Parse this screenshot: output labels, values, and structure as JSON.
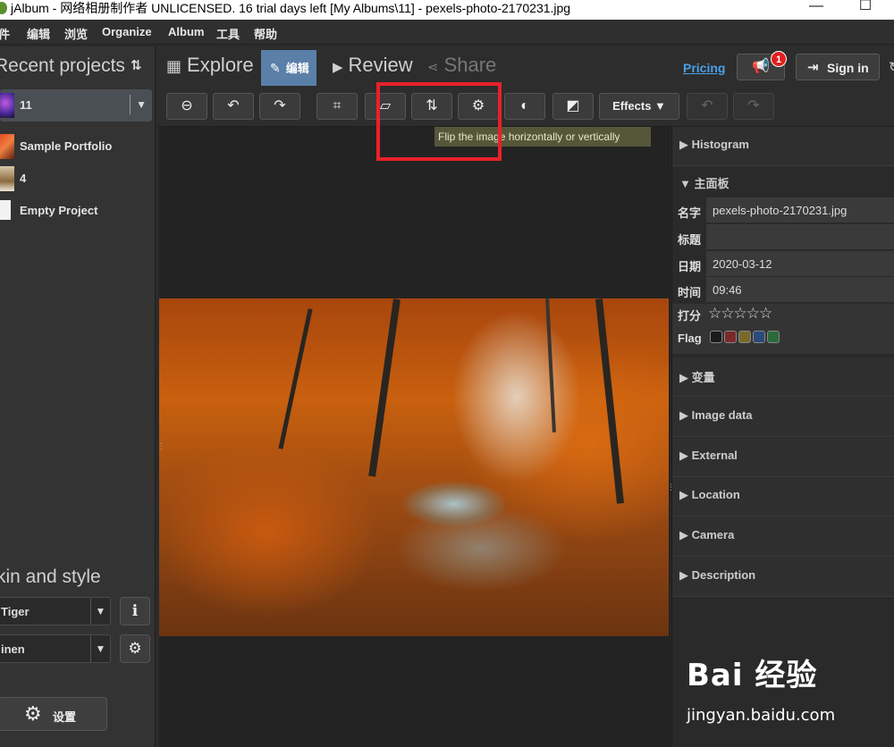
{
  "window": {
    "title": "jAlbum - 网络相册制作者 UNLICENSED. 16 trial days left [My Albums\\11] - pexels-photo-2170231.jpg",
    "minimize": "—",
    "maximize": "☐"
  },
  "menu": [
    "件",
    "编辑",
    "浏览",
    "Organize",
    "Album",
    "工具",
    "帮助"
  ],
  "left": {
    "recent_header": "Recent projects",
    "sort_icon": "⇅",
    "projects": [
      {
        "label": "11",
        "selected": true
      },
      {
        "label": "Sample Portfolio"
      },
      {
        "label": "4"
      },
      {
        "label": "Empty Project"
      }
    ],
    "dropdown_arrow": "▼",
    "skin_header": "kin and style",
    "skin_select": "Tiger",
    "style_select": "inen",
    "select_arrow": "▼",
    "info_icon": "ℹ",
    "gear_icon": "⚙",
    "settings_label": "设置"
  },
  "nav": {
    "explore": "Explore",
    "edit": "编辑",
    "review": "Review",
    "share": "Share",
    "pricing": "Pricing",
    "notif_count": "1",
    "sign_in": "Sign in"
  },
  "toolbar": {
    "effects": "Effects ▼",
    "tooltip": "Flip the image horizontally or vertically"
  },
  "right": {
    "histogram": "▶ Histogram",
    "main_panel": "▼ 主面板",
    "fields": [
      {
        "key": "名字",
        "value": "pexels-photo-2170231.jpg"
      },
      {
        "key": "标题",
        "value": ""
      },
      {
        "key": "日期",
        "value": "2020-03-12"
      },
      {
        "key": "时间",
        "value": "09:46"
      }
    ],
    "rating_label": "打分",
    "rating_stars": "☆☆☆☆☆",
    "rating_value": 0,
    "flag_label": "Flag",
    "flag_colors": [
      "#1a1a1a",
      "#7a2a2a",
      "#7a6a2a",
      "#2a4a7a",
      "#2a6a3a"
    ],
    "sections": [
      "▶ 变量",
      "▶ Image data",
      "▶ External",
      "▶ Location",
      "▶ Camera",
      "▶ Description"
    ]
  },
  "watermark": {
    "brand": "Bai 经验",
    "url": "jingyan.baidu.com"
  }
}
